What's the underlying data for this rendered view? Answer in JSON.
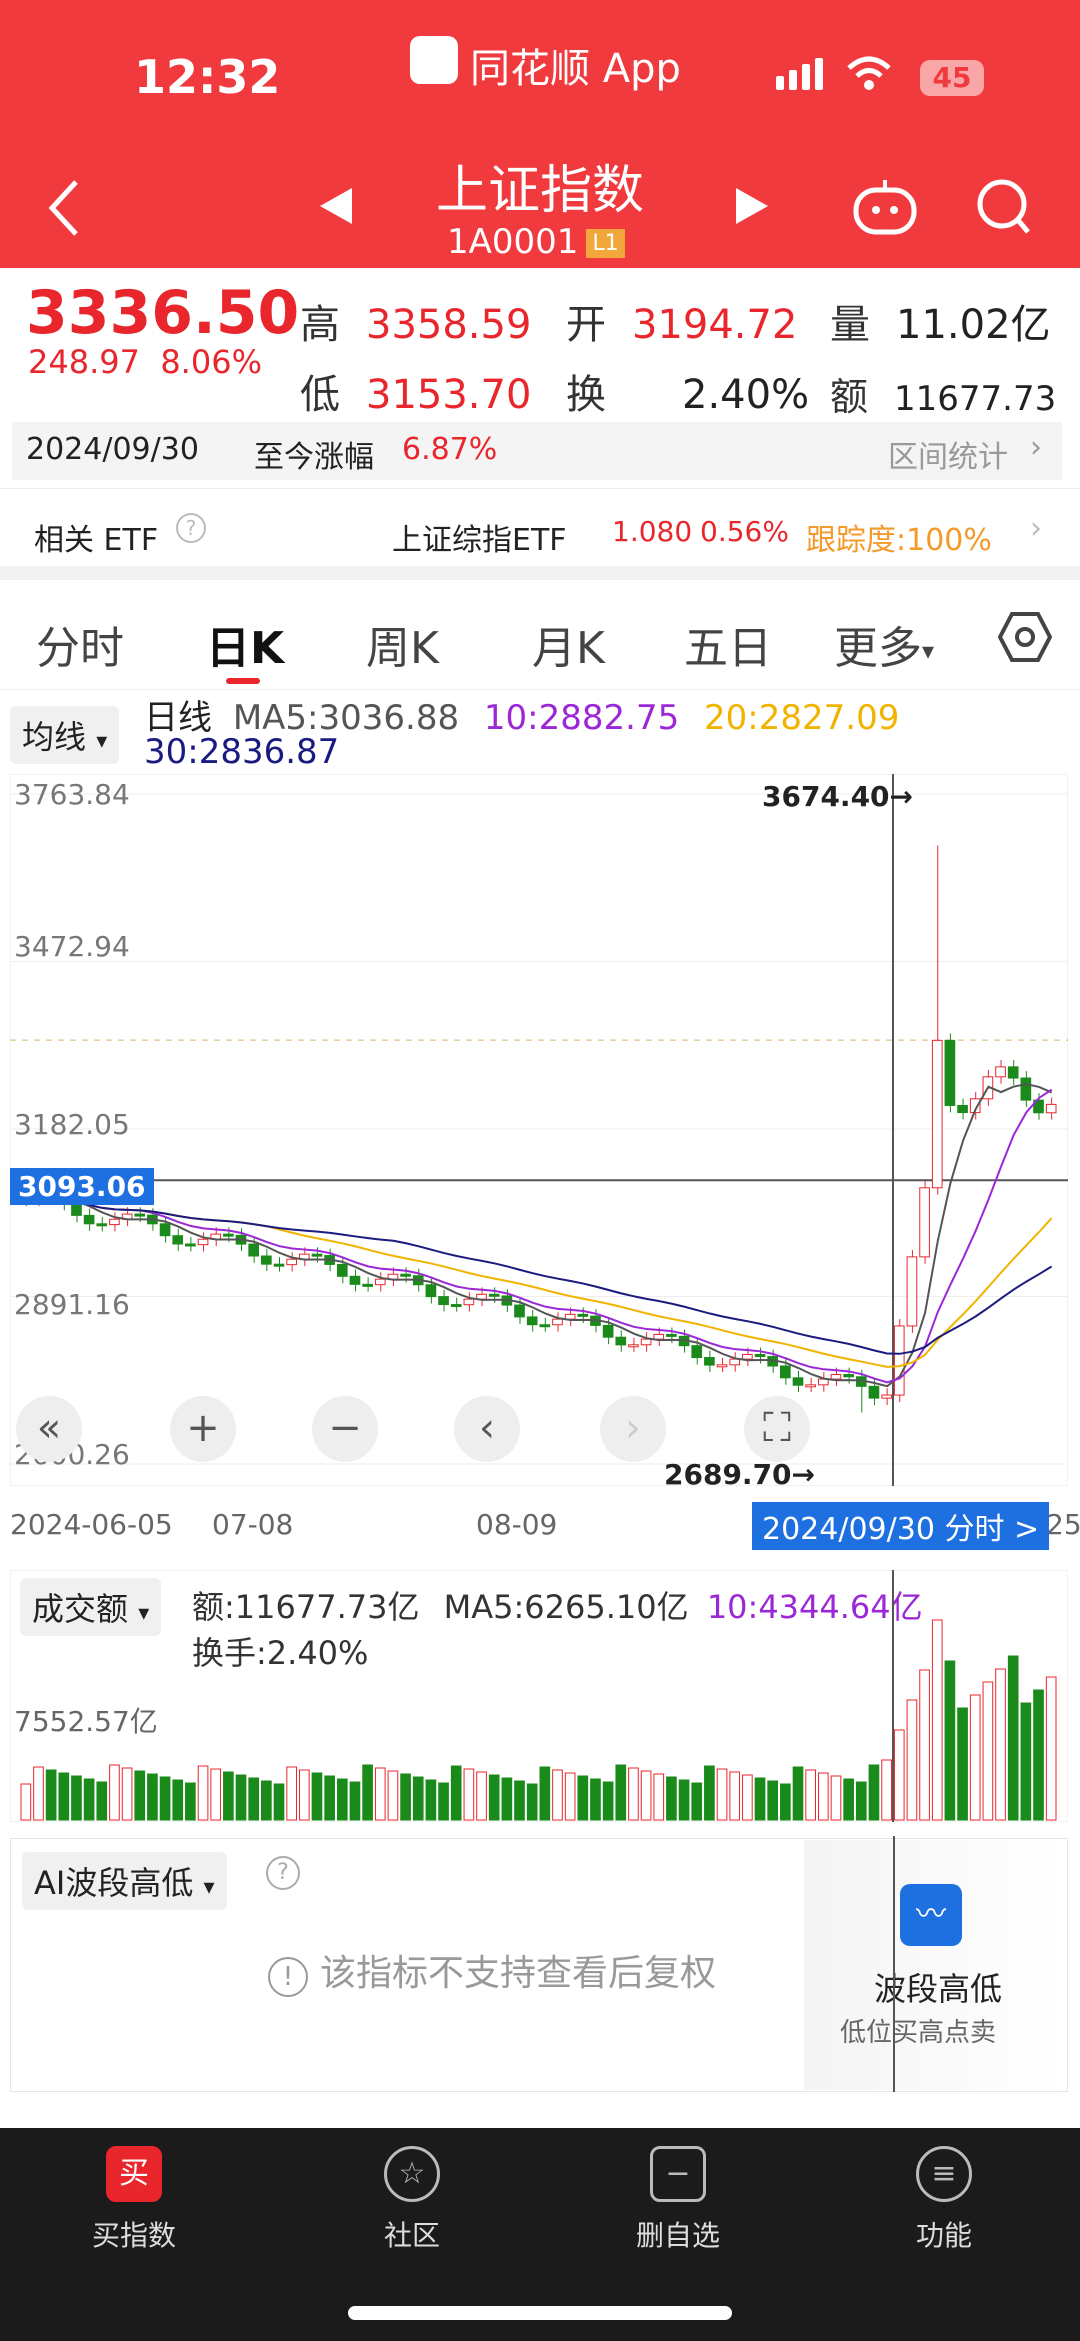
{
  "status": {
    "time": "12:32",
    "battery": "45",
    "app_name": "同花顺 App"
  },
  "header": {
    "title": "上证指数",
    "code": "1A0001",
    "level": "L1"
  },
  "quote": {
    "price": "3336.50",
    "change": "248.97",
    "change_pct": "8.06%",
    "high_label": "高",
    "high": "3358.59",
    "open_label": "开",
    "open": "3194.72",
    "volume_label": "量",
    "volume": "11.02亿",
    "low_label": "低",
    "low": "3153.70",
    "turnover_label": "换",
    "turnover": "2.40%",
    "amount_label": "额",
    "amount": "11677.73亿"
  },
  "range": {
    "date": "2024/09/30",
    "label": "至今涨幅",
    "value": "6.87%",
    "stats": "区间统计"
  },
  "etf": {
    "label": "相关 ETF",
    "name": "上证综指ETF",
    "price": "1.080",
    "pct": "0.56%",
    "tracking": "跟踪度:100%"
  },
  "tabs": [
    "分时",
    "日K",
    "周K",
    "月K",
    "五日",
    "更多"
  ],
  "kline": {
    "indicator": "均线",
    "period": "日线",
    "ma5": "MA5:3036.88",
    "ma10": "10:2882.75",
    "ma20": "20:2827.09",
    "ma30": "30:2836.87",
    "y_labels": [
      "3763.84",
      "3472.94",
      "3182.05",
      "2891.16",
      "2600.26"
    ],
    "cursor_price": "3093.06",
    "max_label": "3674.40→",
    "min_label": "2689.70→",
    "x_labels": [
      "2024-06-05",
      "07-08",
      "08-09",
      "25"
    ],
    "cursor_date": "2024/09/30 分时 >"
  },
  "volume": {
    "indicator": "成交额",
    "amount": "额:11677.73亿",
    "ma5": "MA5:6265.10亿",
    "ma10": "10:4344.64亿",
    "turnover": "换手:2.40%",
    "y_label": "7552.57亿"
  },
  "ai": {
    "indicator": "AI波段高低",
    "notice": "该指标不支持查看后复权",
    "card_title": "波段高低",
    "card_sub": "低位买高点卖"
  },
  "nav": [
    "买指数",
    "社区",
    "删自选",
    "功能"
  ],
  "chart_data": {
    "type": "candlestick",
    "y_range": [
      2600.26,
      3763.84
    ],
    "max_high": 3674.4,
    "min_low": 2689.7,
    "last_close": 3336.5,
    "ma": {
      "MA5": 3036.88,
      "MA10": 2882.75,
      "MA20": 2827.09,
      "MA30": 2836.87
    },
    "colors": {
      "up": "#e8262c",
      "down": "#1a8a1a",
      "ma5": "#555555",
      "ma10": "#9b27d6",
      "ma20": "#f0b400",
      "ma30": "#1a1a80"
    }
  }
}
